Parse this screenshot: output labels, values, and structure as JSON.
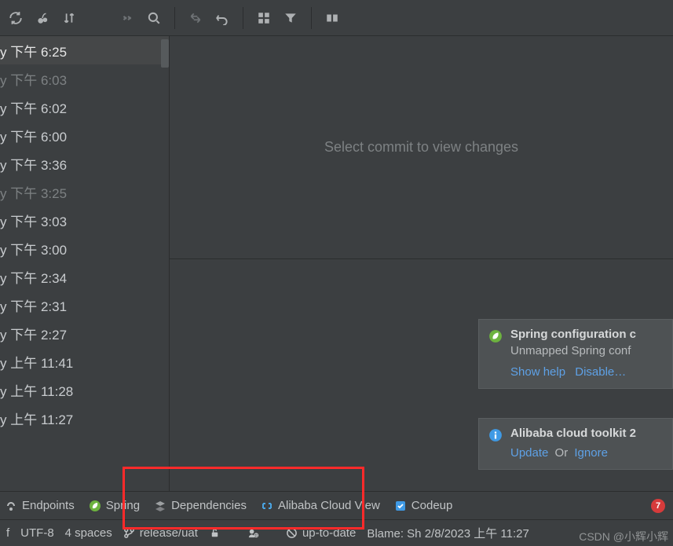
{
  "toolbar": {
    "icons": [
      "refresh",
      "cherry-pick",
      "sort",
      "more",
      "search",
      "sep",
      "swap",
      "undo",
      "sep",
      "grid",
      "filter",
      "sep",
      "compare"
    ]
  },
  "detail": {
    "placeholder": "Select commit to view changes"
  },
  "commits": [
    {
      "text": "y 下午 6:25",
      "state": "sel"
    },
    {
      "text": "y 下午 6:03",
      "state": "dim"
    },
    {
      "text": "y 下午 6:02",
      "state": "norm"
    },
    {
      "text": "y 下午 6:00",
      "state": "norm"
    },
    {
      "text": "y 下午 3:36",
      "state": "norm"
    },
    {
      "text": "y 下午 3:25",
      "state": "dim"
    },
    {
      "text": "y 下午 3:03",
      "state": "norm"
    },
    {
      "text": "y 下午 3:00",
      "state": "norm"
    },
    {
      "text": "y 下午 2:34",
      "state": "norm"
    },
    {
      "text": "y 下午 2:31",
      "state": "norm"
    },
    {
      "text": "y 下午 2:27",
      "state": "norm"
    },
    {
      "text": "y 上午 11:41",
      "state": "norm"
    },
    {
      "text": "y 上午 11:28",
      "state": "norm"
    },
    {
      "text": "y 上午 11:27",
      "state": "norm"
    }
  ],
  "notifications": [
    {
      "icon": "spring",
      "title": "Spring configuration c",
      "body": "Unmapped Spring conf",
      "links": [
        {
          "label": "Show help"
        },
        {
          "label": "Disable…"
        }
      ],
      "sep": "   "
    },
    {
      "icon": "info",
      "title": "Alibaba cloud toolkit 2",
      "body": "",
      "links": [
        {
          "label": "Update"
        },
        {
          "label": "Ignore"
        }
      ],
      "sep": " Or "
    }
  ],
  "tool_tabs": [
    {
      "icon": "endpoints",
      "label": "Endpoints"
    },
    {
      "icon": "spring",
      "label": "Spring"
    },
    {
      "icon": "deps",
      "label": "Dependencies"
    },
    {
      "icon": "alibaba",
      "label": "Alibaba Cloud View"
    },
    {
      "icon": "codeup",
      "label": "Codeup"
    }
  ],
  "tool_tabs_badge": "7",
  "status": {
    "left_trunc": "f",
    "encoding": "UTF-8",
    "indent": "4 spaces",
    "branch": "release/uat",
    "sync_status": "up-to-date",
    "blame": "Blame: Sh 2/8/2023 上午 11:27"
  },
  "watermark": "CSDN @小辉小辉"
}
